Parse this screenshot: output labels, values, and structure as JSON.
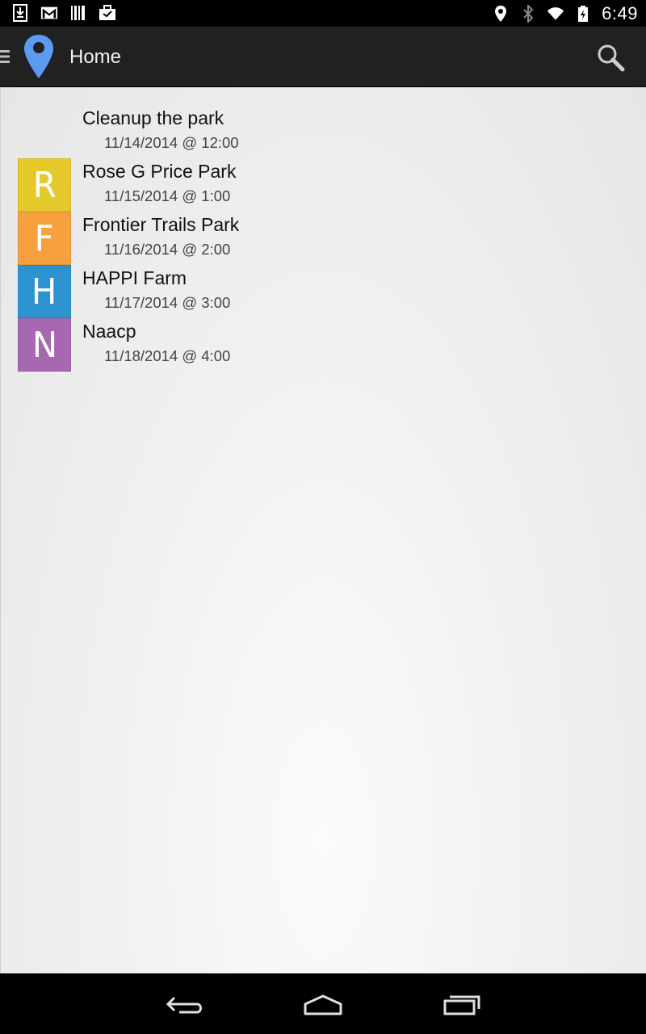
{
  "status_bar": {
    "time": "6:49",
    "left_icons": [
      "download-icon",
      "gmail-icon",
      "barcode-icon",
      "briefcase-icon"
    ],
    "right_icons": [
      "location-icon",
      "bluetooth-icon",
      "wifi-icon",
      "battery-icon"
    ]
  },
  "action_bar": {
    "title": "Home",
    "background": "#212121",
    "app_icon_color": "#5b9bf4"
  },
  "events": [
    {
      "name": "Cleanup the park",
      "date": "11/14/2014 @ 12:00",
      "letter": "",
      "color": ""
    },
    {
      "name": "Rose G Price Park",
      "date": "11/15/2014 @ 1:00",
      "letter": "R",
      "color": "#e5c92b"
    },
    {
      "name": "Frontier Trails Park",
      "date": "11/16/2014 @ 2:00",
      "letter": "F",
      "color": "#f6a13e"
    },
    {
      "name": "HAPPI Farm",
      "date": "11/17/2014 @ 3:00",
      "letter": "H",
      "color": "#2c93d0"
    },
    {
      "name": "Naacp",
      "date": "11/18/2014 @ 4:00",
      "letter": "N",
      "color": "#a768b1"
    }
  ],
  "nav_bar": {
    "buttons": [
      "back-icon",
      "home-icon",
      "recent-apps-icon"
    ]
  }
}
